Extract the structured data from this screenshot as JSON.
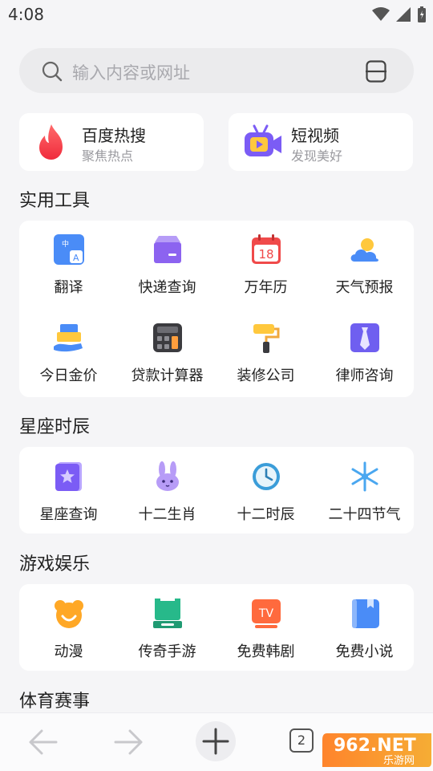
{
  "status": {
    "time": "4:08"
  },
  "search": {
    "placeholder": "输入内容或网址"
  },
  "quick": [
    {
      "title": "百度热搜",
      "subtitle": "聚焦热点",
      "icon": "flame-icon"
    },
    {
      "title": "短视频",
      "subtitle": "发现美好",
      "icon": "video-camera-icon"
    }
  ],
  "sections": {
    "tools": {
      "title": "实用工具",
      "items": [
        {
          "label": "翻译",
          "icon": "translate-icon"
        },
        {
          "label": "快递查询",
          "icon": "package-icon"
        },
        {
          "label": "万年历",
          "icon": "calendar-icon",
          "day": "18"
        },
        {
          "label": "天气预报",
          "icon": "weather-icon"
        },
        {
          "label": "今日金价",
          "icon": "gold-icon"
        },
        {
          "label": "贷款计算器",
          "icon": "calculator-icon"
        },
        {
          "label": "装修公司",
          "icon": "paint-roller-icon"
        },
        {
          "label": "律师咨询",
          "icon": "tie-icon"
        }
      ]
    },
    "horoscope": {
      "title": "星座时辰",
      "items": [
        {
          "label": "星座查询",
          "icon": "star-book-icon"
        },
        {
          "label": "十二生肖",
          "icon": "rabbit-icon"
        },
        {
          "label": "十二时辰",
          "icon": "clock-icon"
        },
        {
          "label": "二十四节气",
          "icon": "snowflake-icon"
        }
      ]
    },
    "games": {
      "title": "游戏娱乐",
      "items": [
        {
          "label": "动漫",
          "icon": "bear-face-icon"
        },
        {
          "label": "传奇手游",
          "icon": "game-controller-icon"
        },
        {
          "label": "免费韩剧",
          "icon": "tv-icon",
          "badge": "TV"
        },
        {
          "label": "免费小说",
          "icon": "book-icon"
        }
      ]
    },
    "sports": {
      "title": "体育赛事"
    }
  },
  "bottom": {
    "tab_count": "2"
  },
  "watermark": {
    "text_main": "962.NET",
    "text_sub": "乐游网"
  }
}
